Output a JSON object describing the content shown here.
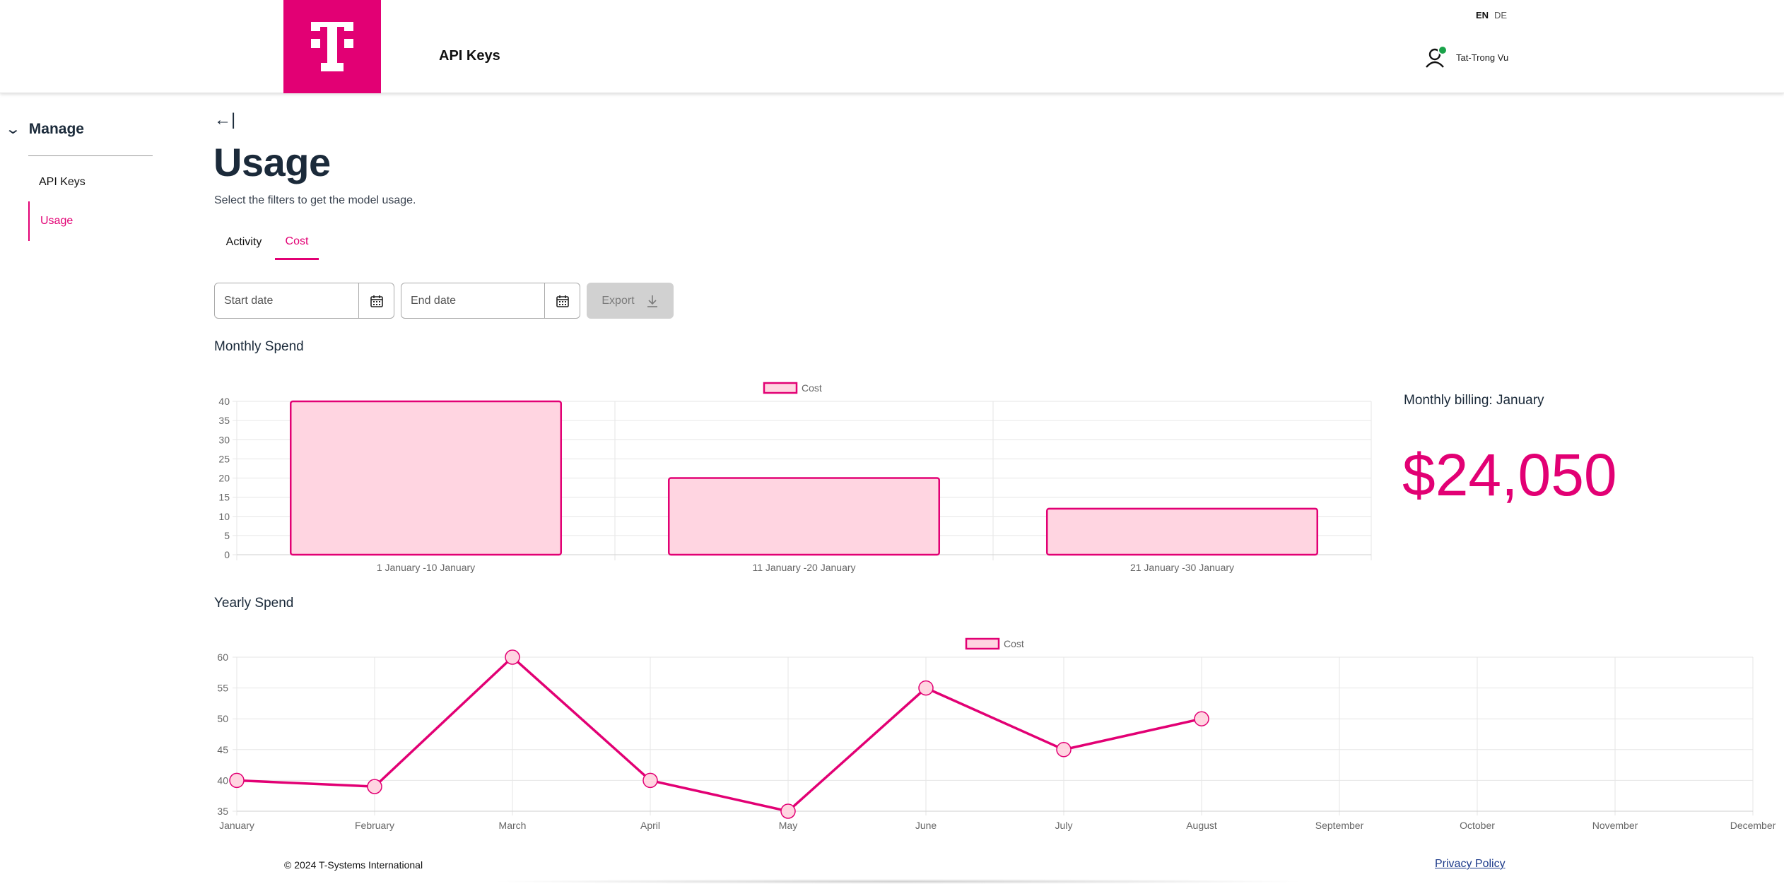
{
  "header": {
    "app_title": "API Keys",
    "lang_en": "EN",
    "lang_de": "DE",
    "user_name": "Tat-Trong Vu",
    "logo_letter": "T",
    "brand_color": "#e20074"
  },
  "sidebar": {
    "section": "Manage",
    "items": [
      {
        "label": "API Keys",
        "active": false
      },
      {
        "label": "Usage",
        "active": true
      }
    ]
  },
  "main": {
    "back_symbol": "←|",
    "title": "Usage",
    "subtitle": "Select the filters to get the model usage.",
    "tabs": [
      {
        "label": "Activity",
        "active": false
      },
      {
        "label": "Cost",
        "active": true
      }
    ],
    "start_date_placeholder": "Start date",
    "end_date_placeholder": "End date",
    "export_label": "Export",
    "monthly_title": "Monthly Spend",
    "yearly_title": "Yearly Spend",
    "billing_label": "Monthly billing: January",
    "billing_value": "$24,050"
  },
  "footer": {
    "copyright": "© 2024 T-Systems International",
    "privacy": "Privacy Policy"
  },
  "chart_data": [
    {
      "type": "bar",
      "title": "",
      "legend": [
        "Cost"
      ],
      "legend_position": "top",
      "categories": [
        "1 January -10 January",
        "11 January -20 January",
        "21 January -30 January"
      ],
      "series": [
        {
          "name": "Cost",
          "values": [
            40,
            20,
            12
          ]
        }
      ],
      "yticks": [
        0,
        5,
        10,
        15,
        20,
        25,
        30,
        35,
        40
      ],
      "ylim": [
        0,
        40
      ],
      "grid": true,
      "color": "#e20074",
      "fill": "#ffd5e1"
    },
    {
      "type": "line",
      "title": "",
      "legend": [
        "Cost"
      ],
      "legend_position": "top",
      "categories": [
        "January",
        "February",
        "March",
        "April",
        "May",
        "June",
        "July",
        "August",
        "September",
        "October",
        "November",
        "December"
      ],
      "series": [
        {
          "name": "Cost",
          "values": [
            40,
            39,
            60,
            40,
            35,
            55,
            45,
            50
          ]
        }
      ],
      "yticks": [
        35,
        40,
        45,
        50,
        55,
        60
      ],
      "ylim": [
        35,
        60
      ],
      "grid": true,
      "color": "#e20074",
      "fill": "#ffd5e1"
    }
  ]
}
